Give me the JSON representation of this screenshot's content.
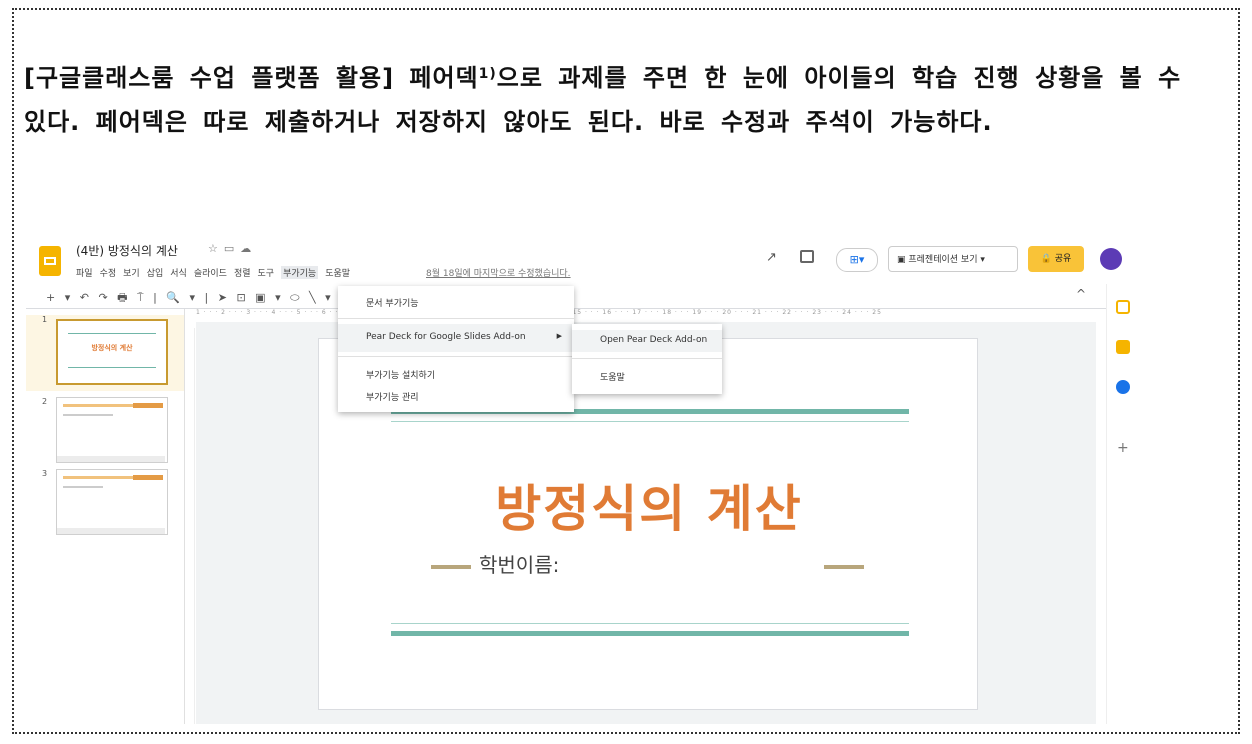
{
  "caption": {
    "part1": "[구글클래스룸 수업 플랫폼 활용] 페어덱",
    "footnote": "1)",
    "part2": "으로 과제를 주면 한 눈에 아이들의 학습 진행 상황을 볼 수 있다. 페어덱은 따로 제출하거나 저장하지 않아도 된다. 바로 수정과 주석이 가능하다."
  },
  "app": {
    "doc_title": "(4반) 방정식의 계산",
    "title_icons": [
      "star-icon",
      "folder-icon",
      "cloud-icon"
    ],
    "menu": [
      "파일",
      "수정",
      "보기",
      "삽입",
      "서식",
      "슬라이드",
      "정렬",
      "도구",
      "부가기능",
      "도움말"
    ],
    "active_menu": "부가기능",
    "last_edit": "8월 18일에 마지막으로 수정했습니다.",
    "present_label": "프레젠테이션 보기",
    "share_label": "공유",
    "accent_color": "#f9c338",
    "logo_color": "#f5b400"
  },
  "dropdown": {
    "item_docs_addons": "문서 부가기능",
    "item_peardeck": "Pear Deck for Google Slides Add-on",
    "item_install": "부가기능 설치하기",
    "item_manage": "부가기능 관리"
  },
  "submenu": {
    "item_open": "Open Pear Deck Add-on",
    "item_help": "도움말"
  },
  "slides": {
    "numbers": [
      "1",
      "2",
      "3"
    ],
    "ruler": "1 · · · 2 · · · 3 · · · 4 · · · 5 · · · 6 · · · 7 · · · 8 · · · 9 · · · 10 · · · 11 · · · 12 · · · 13 · · · 14 · · · 15 · · · 16 · · · 17 · · · 18 · · · 19 · · · 20 · · · 21 · · · 22 · · · 23 · · · 24 · · · 25"
  },
  "slide": {
    "title": "방정식의 계산",
    "subtitle": "학번이름:",
    "title_color": "#e07b35",
    "line_color": "#71b6a8"
  }
}
